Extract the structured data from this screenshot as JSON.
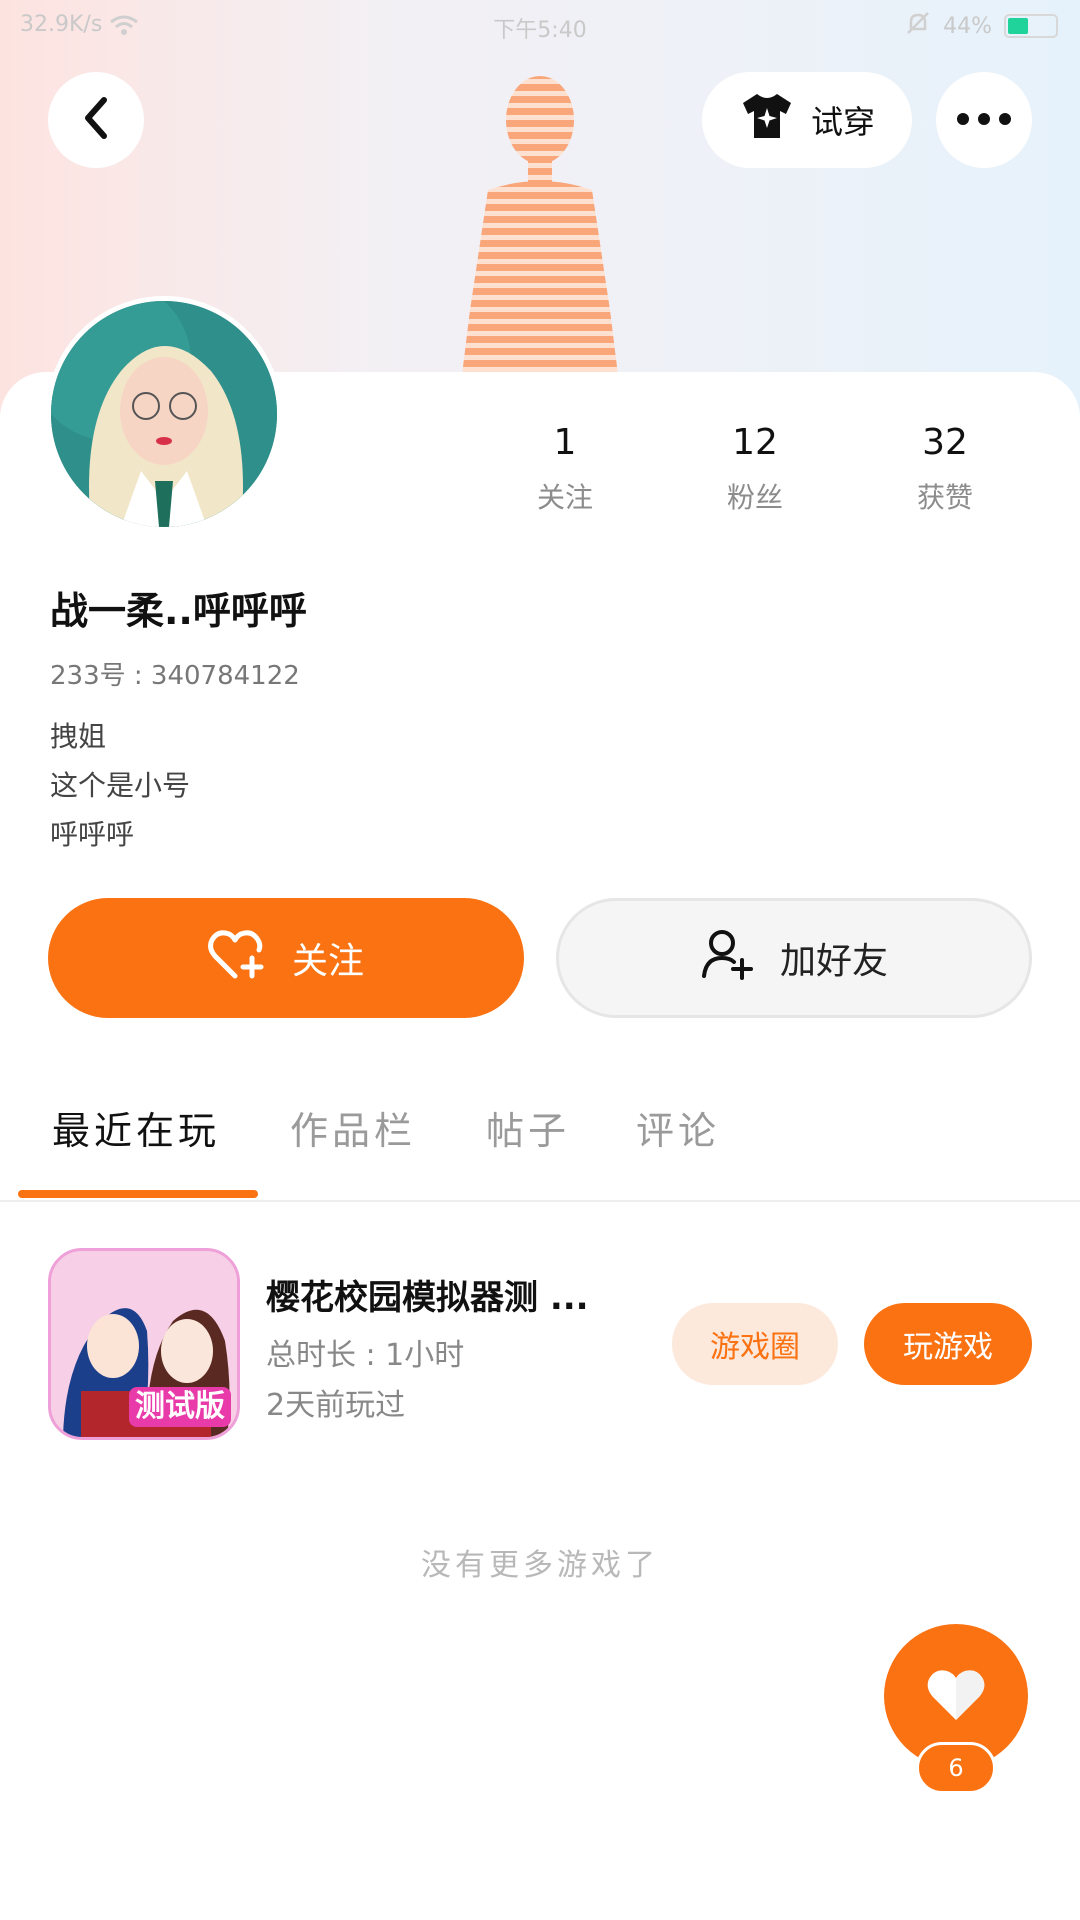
{
  "status_bar": {
    "left_text": "32.9K/s",
    "time": "下午5:40",
    "battery": "44%",
    "battery_level": 0.44
  },
  "header": {
    "tryon_label": "试穿"
  },
  "profile": {
    "stats": [
      {
        "value": "1",
        "label": "关注"
      },
      {
        "value": "12",
        "label": "粉丝"
      },
      {
        "value": "32",
        "label": "获赞"
      }
    ],
    "nickname": "战一柔..呼呼呼",
    "user_id": "233号 : 340784122",
    "bio_lines": [
      "拽姐",
      "这个是小号",
      "呼呼呼"
    ]
  },
  "actions": {
    "follow_label": "关注",
    "add_friend_label": "加好友"
  },
  "tabs": [
    "最近在玩",
    "作品栏",
    "帖子",
    "评论"
  ],
  "recent_games": [
    {
      "title": "樱花校园模拟器测 ...",
      "total_time": "总时长 : 1小时",
      "last_played": "2天前玩过",
      "icon_badge": "测试版",
      "circle_label": "游戏圈",
      "play_label": "玩游戏"
    }
  ],
  "no_more_text": "没有更多游戏了",
  "like_count": "6",
  "colors": {
    "accent": "#fa7212",
    "accent_light": "#fde9dc"
  }
}
